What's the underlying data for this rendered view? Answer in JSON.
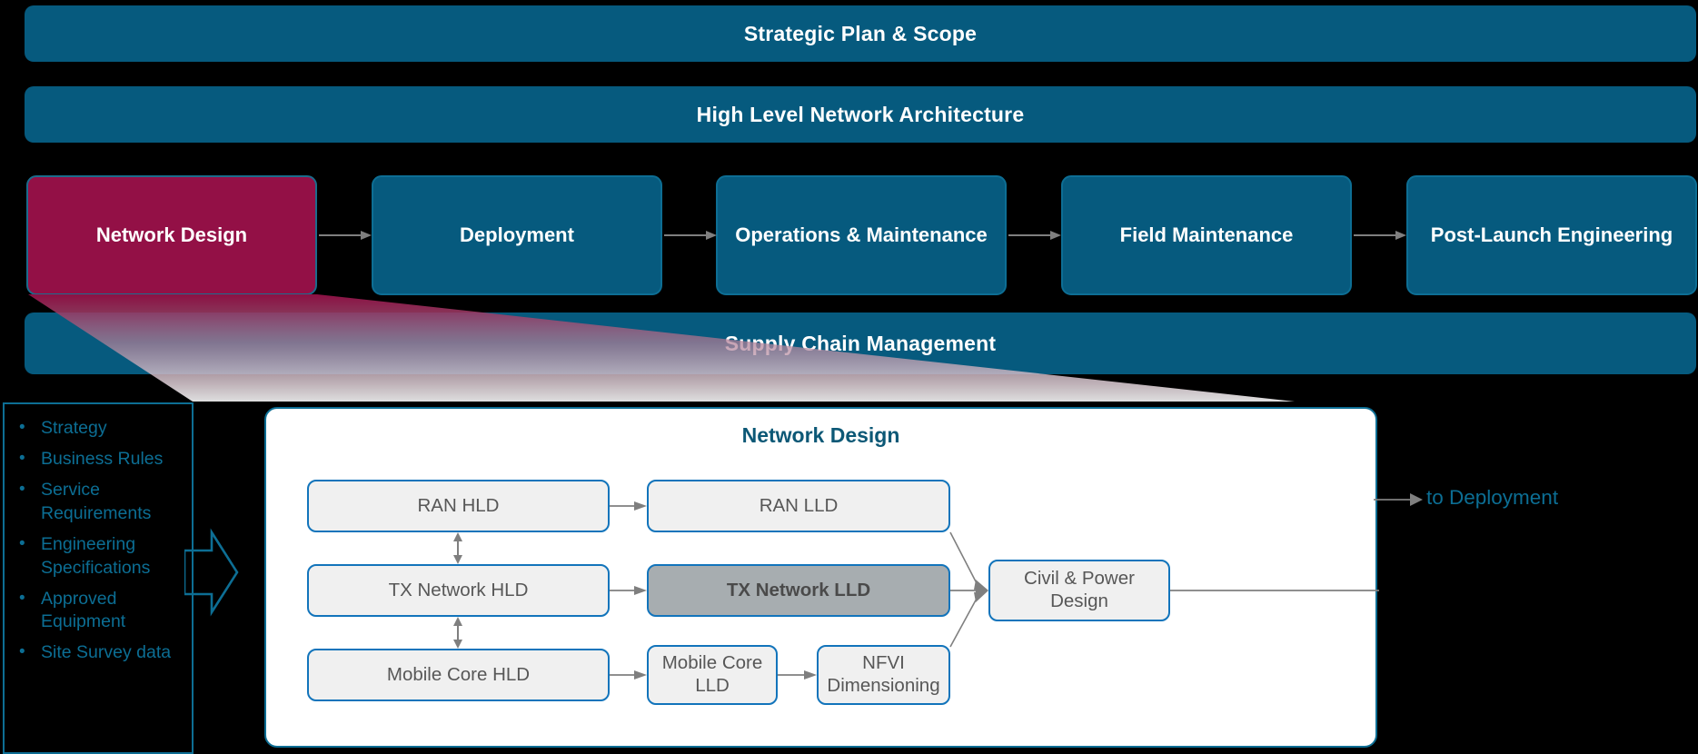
{
  "colors": {
    "background": "#000000",
    "band_teal": "#065A7E",
    "active_magenta": "#931046",
    "node_border_blue": "#1274bb",
    "node_fill": "#f0f0f0",
    "node_highlight_fill": "#a7adb0",
    "panel_title_teal": "#0c5876",
    "bullet_teal": "#0c6e94",
    "connector_gray": "#7f7f7f"
  },
  "bands": {
    "strategic_plan": "Strategic Plan & Scope",
    "high_level_architecture": "High Level Network Architecture",
    "supply_chain": "Supply Chain Management"
  },
  "phases": [
    {
      "label": "Network Design",
      "active": true
    },
    {
      "label": "Deployment",
      "active": false
    },
    {
      "label": "Operations & Maintenance",
      "active": false
    },
    {
      "label": "Field Maintenance",
      "active": false
    },
    {
      "label": "Post-Launch Engineering",
      "active": false
    }
  ],
  "inputs": {
    "items": [
      "Strategy",
      "Business Rules",
      "Service Requirements",
      "Engineering Specifications",
      "Approved Equipment",
      "Site Survey data"
    ]
  },
  "detail": {
    "title": "Network Design",
    "nodes": {
      "ran_hld": "RAN HLD",
      "tx_hld": "TX Network HLD",
      "mc_hld": "Mobile Core HLD",
      "ran_lld": "RAN LLD",
      "tx_lld": "TX Network LLD",
      "mc_lld": "Mobile Core LLD",
      "nfvi": "NFVI Dimensioning",
      "civil": "Civil & Power Design"
    },
    "highlighted_node": "TX Network LLD"
  },
  "output": {
    "to_deployment": "to Deployment"
  }
}
